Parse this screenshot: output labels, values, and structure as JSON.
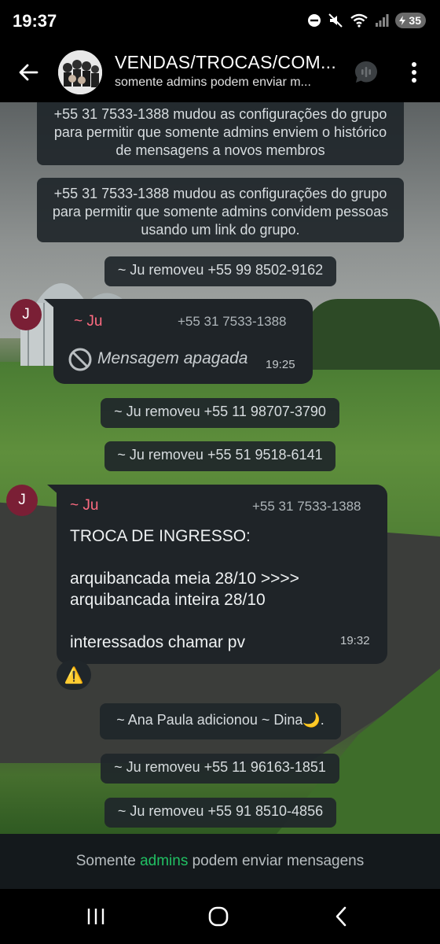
{
  "status_bar": {
    "time": "19:37",
    "battery_level": "35"
  },
  "header": {
    "title": "VENDAS/TROCAS/COM...",
    "subtitle": "somente admins podem enviar m..."
  },
  "messages": {
    "sys1": "+55 31 7533-1388 mudou as configurações do grupo para permitir que somente admins enviem o histórico de mensagens a novos membros",
    "sys2": "+55 31 7533-1388 mudou as configurações do grupo para permitir que somente admins convidem pessoas usando um link do grupo.",
    "sys3": "~ Ju removeu +55 99 8502-9162",
    "bubble1": {
      "avatar_letter": "J",
      "sender": "~ Ju",
      "phone": "+55 31 7533-1388",
      "text": "Mensagem apagada",
      "time": "19:25"
    },
    "sys4": "~ Ju removeu +55 11 98707-3790",
    "sys5": "~ Ju removeu +55 51 9518-6141",
    "bubble2": {
      "avatar_letter": "J",
      "sender": "~ Ju",
      "phone": "+55 31 7533-1388",
      "text": "TROCA DE INGRESSO:\n\narquibancada meia 28/10 >>>>\narquibancada inteira 28/10\n\ninteressados chamar pv",
      "time": "19:32",
      "reaction": "⚠️"
    },
    "sys6": "~ Ana Paula adicionou ~ Dina🌙.",
    "sys7": "~ Ju removeu +55 11 96163-1851",
    "sys8": "~ Ju removeu +55 91 8510-4856"
  },
  "footer": {
    "prefix": "Somente ",
    "link": "admins",
    "suffix": " podem enviar mensagens"
  },
  "colors": {
    "accent": "#21c063",
    "sender_name": "#ff6b81",
    "bubble": "#1f2428"
  },
  "icons": {
    "back": "back-arrow-icon",
    "call": "voice-chat-icon",
    "menu": "more-vert-icon",
    "deleted": "blocked-circle-icon",
    "reaction": "warning-icon"
  }
}
